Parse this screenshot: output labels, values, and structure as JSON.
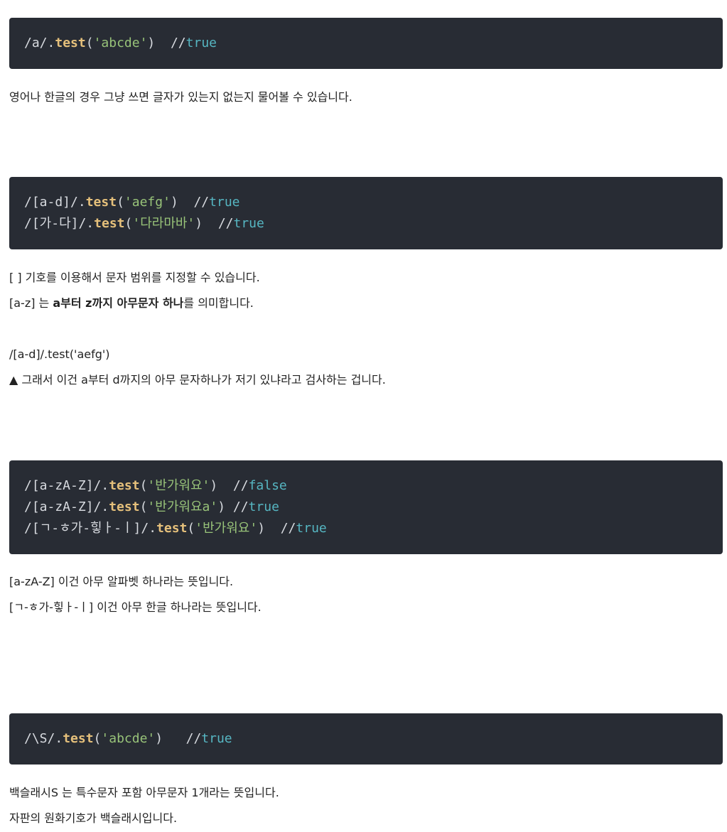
{
  "blocks": [
    {
      "lines": [
        {
          "pre": "/a/.",
          "fn": "test",
          "open": "(",
          "arg": "'abcde'",
          "close": ")",
          "gap": "  ",
          "cm": "//",
          "res": "true"
        }
      ]
    },
    {
      "lines": [
        {
          "pre": "/[a-d]/.",
          "fn": "test",
          "open": "(",
          "arg": "'aefg'",
          "close": ")",
          "gap": "  ",
          "cm": "//",
          "res": "true"
        },
        {
          "pre": "/[가-다]/.",
          "fn": "test",
          "open": "(",
          "arg": "'다라마바'",
          "close": ")",
          "gap": "  ",
          "cm": "//",
          "res": "true"
        }
      ]
    },
    {
      "lines": [
        {
          "pre": "/[a-zA-Z]/.",
          "fn": "test",
          "open": "(",
          "arg": "'반가워요'",
          "close": ")",
          "gap": "  ",
          "cm": "//",
          "res": "false"
        },
        {
          "pre": "/[a-zA-Z]/.",
          "fn": "test",
          "open": "(",
          "arg": "'반가워요a'",
          "close": ")",
          "gap": " ",
          "cm": "//",
          "res": "true"
        },
        {
          "pre": "/[ㄱ-ㅎ가-힣ㅏ-ㅣ]/.",
          "fn": "test",
          "open": "(",
          "arg": "'반가워요'",
          "close": ")",
          "gap": "  ",
          "cm": "//",
          "res": "true"
        }
      ]
    },
    {
      "lines": [
        {
          "pre": "/\\S/.",
          "fn": "test",
          "open": "(",
          "arg": "'abcde'",
          "close": ")",
          "gap": "   ",
          "cm": "//",
          "res": "true"
        }
      ]
    }
  ],
  "paragraphs": {
    "p1": "영어나 한글의 경우 그냥 쓰면 글자가 있는지 없는지 물어볼 수 있습니다.",
    "p2": "[ ] 기호를 이용해서 문자 범위를 지정할 수 있습니다.",
    "p3_pre": "[a-z] 는 ",
    "p3_bold": "a부터 z까지 아무문자 하나",
    "p3_post": "를 의미합니다.",
    "p4": "/[a-d]/.test('aefg')",
    "p5": "▲ 그래서 이건 a부터 d까지의 아무 문자하나가 저기 있냐라고 검사하는 겁니다.",
    "p6": "[a-zA-Z] 이건 아무 알파벳 하나라는 뜻입니다.",
    "p7": "[ㄱ-ㅎ가-힣ㅏ-ㅣ] 이건 아무 한글 하나라는 뜻입니다.",
    "p8": "백슬래시S 는 특수문자 포함 아무문자 1개라는 뜻입니다.",
    "p9": "자판의 원화기호가 백슬래시입니다."
  }
}
